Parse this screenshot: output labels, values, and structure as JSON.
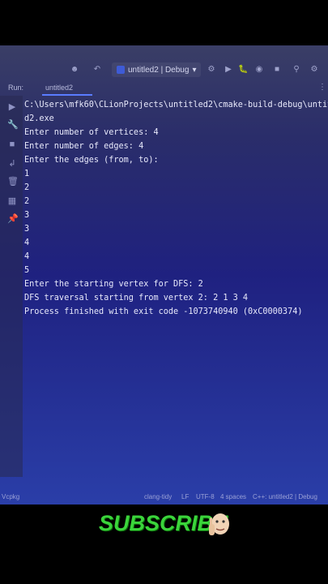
{
  "toolbar": {
    "run_config_label": "untitled2 | Debug"
  },
  "run_panel": {
    "label": "Run:",
    "tab_label": "untitled2"
  },
  "console_lines": [
    "C:\\Users\\mfk60\\CLionProjects\\untitled2\\cmake-build-debug\\untit",
    "d2.exe",
    "Enter number of vertices: 4",
    "Enter number of edges: 4",
    "Enter the edges (from, to):",
    "1",
    "2",
    "2",
    "3",
    "3",
    "4",
    "4",
    "5",
    "Enter the starting vertex for DFS: 2",
    "DFS traversal starting from vertex 2: 2 1 3 4",
    "Process finished with exit code -1073740940 (0xC0000374)"
  ],
  "statusbar": {
    "left": "Vcpkg",
    "linter": "clang-tidy",
    "line_ending": "LF",
    "encoding": "UTF-8",
    "indent": "4 spaces",
    "context": "C++: untitled2 | Debug"
  },
  "overlay": {
    "subscribe_text": "SUBSCRIBE"
  },
  "colors": {
    "screen_bg": "#1f2180",
    "console_text": "#e8e9fb",
    "subscribe_green": "#3bd43b"
  }
}
